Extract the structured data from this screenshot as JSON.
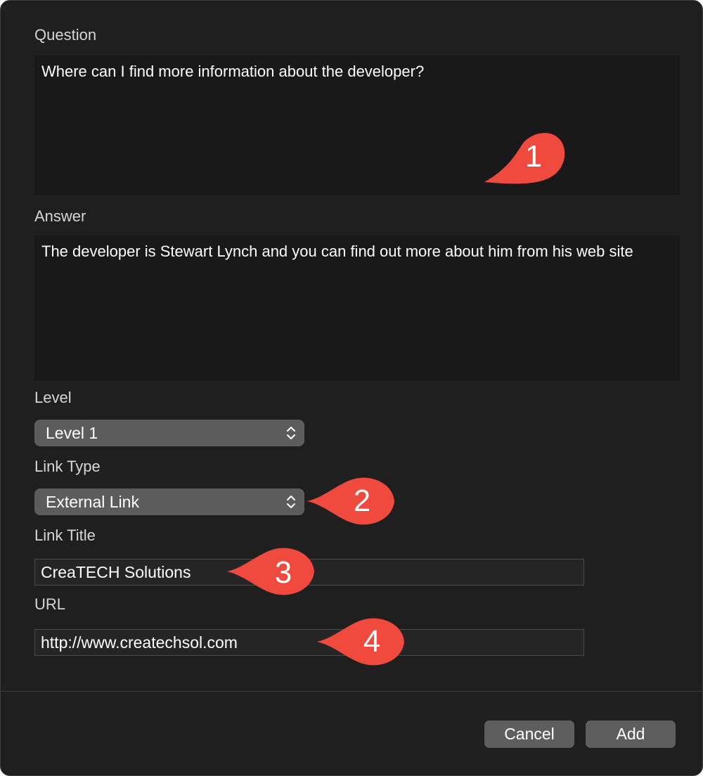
{
  "form": {
    "question_label": "Question",
    "question_value": "Where can I find more information about the developer?",
    "answer_label": "Answer",
    "answer_value": "The developer is Stewart Lynch and you can find out more about him from his web site",
    "level_label": "Level",
    "level_selected": "Level 1",
    "link_type_label": "Link Type",
    "link_type_selected": "External Link",
    "link_title_label": "Link Title",
    "link_title_value": "CreaTECH Solutions",
    "url_label": "URL",
    "url_value": "http://www.createchsol.com"
  },
  "buttons": {
    "cancel_label": "Cancel",
    "add_label": "Add"
  },
  "callouts": [
    "1",
    "2",
    "3",
    "4"
  ],
  "colors": {
    "background": "#1f1f1f",
    "callout": "#f04a3f",
    "popup": "#5c5c5c"
  }
}
